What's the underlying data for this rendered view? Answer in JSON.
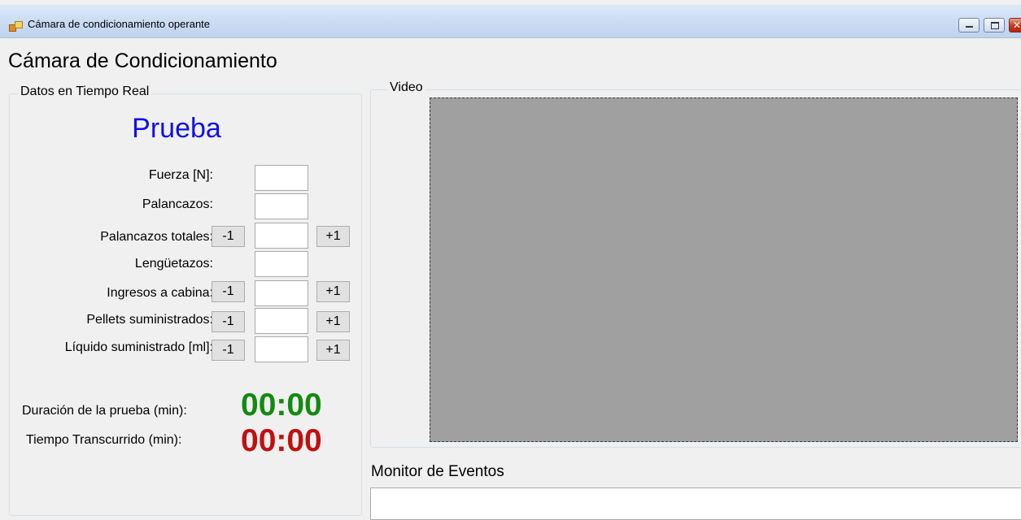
{
  "window": {
    "title": "Cámara de condicionamiento operante",
    "icon": "app-icon",
    "controls": {
      "minimize_icon": "minimize-icon",
      "maximize_icon": "maximize-icon",
      "close_icon": "close-icon"
    }
  },
  "header": {
    "title": "Cámara de Condicionamiento"
  },
  "realtime": {
    "group_label": "Datos en Tiempo Real",
    "mode_title": "Prueba",
    "fields": {
      "fuerza": {
        "label": "Fuerza [N]:",
        "value": ""
      },
      "palancazos": {
        "label": "Palancazos:",
        "value": ""
      },
      "palancazos_totales": {
        "label": "Palancazos totales:",
        "value": "",
        "minus": "-1",
        "plus": "+1"
      },
      "lenguetazos": {
        "label": "Lengüetazos:",
        "value": ""
      },
      "ingresos": {
        "label": "Ingresos a cabina:",
        "value": "",
        "minus": "-1",
        "plus": "+1"
      },
      "pellets": {
        "label": "Pellets suministrados:",
        "value": "",
        "minus": "-1",
        "plus": "+1"
      },
      "liquido": {
        "label": "Líquido suministrado [ml]:",
        "value": "",
        "minus": "-1",
        "plus": "+1"
      }
    },
    "duracion": {
      "label": "Duración de la prueba (min):",
      "value": "00:00"
    },
    "transcurrido": {
      "label": "Tiempo Transcurrido (min):",
      "value": "00:00"
    }
  },
  "video": {
    "group_label": "Video"
  },
  "monitor": {
    "label": "Monitor de Eventos",
    "value": ""
  },
  "colors": {
    "mode_title": "#1010e8",
    "duracion": "#128a12",
    "transcurrido": "#c01010",
    "video_bg": "#a0a0a0"
  }
}
